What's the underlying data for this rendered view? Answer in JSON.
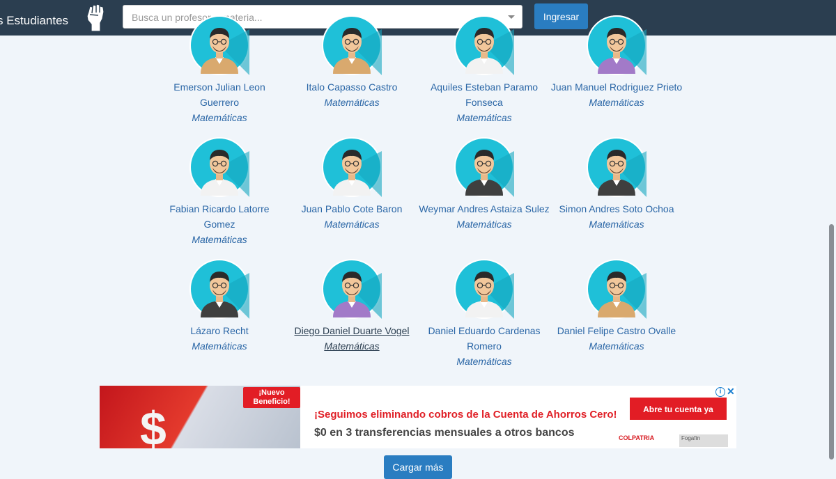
{
  "header": {
    "brand": "s Estudiantes",
    "search_placeholder": "Busca un profesor o materia...",
    "login_label": "Ingresar"
  },
  "teachers": [
    {
      "name": "Emerson Julian Leon Guerrero",
      "subject": "Matemáticas",
      "avatar": "avatar-tan-shirt"
    },
    {
      "name": "Italo Capasso Castro",
      "subject": "Matemáticas",
      "avatar": "avatar-tan-shirt"
    },
    {
      "name": "Aquiles Esteban Paramo Fonseca",
      "subject": "Matemáticas",
      "avatar": "avatar-white-shirt"
    },
    {
      "name": "Juan Manuel Rodriguez Prieto",
      "subject": "Matemáticas",
      "avatar": "avatar-purple-shirt"
    },
    {
      "name": "Fabian Ricardo Latorre Gomez",
      "subject": "Matemáticas",
      "avatar": "avatar-white-shirt"
    },
    {
      "name": "Juan Pablo Cote Baron",
      "subject": "Matemáticas",
      "avatar": "avatar-white-shirt"
    },
    {
      "name": "Weymar Andres Astaiza Sulez",
      "subject": "Matemáticas",
      "avatar": "avatar-dark-shirt"
    },
    {
      "name": "Simon Andres Soto Ochoa",
      "subject": "Matemáticas",
      "avatar": "avatar-dark-shirt"
    },
    {
      "name": "Lázaro Recht",
      "subject": "Matemáticas",
      "avatar": "avatar-dark-shirt"
    },
    {
      "name": "Diego Daniel Duarte Vogel",
      "subject": "Matemáticas",
      "avatar": "avatar-purple-shirt"
    },
    {
      "name": "Daniel Eduardo Cardenas Romero",
      "subject": "Matemáticas",
      "avatar": "avatar-white-shirt"
    },
    {
      "name": "Daniel Felipe Castro Ovalle",
      "subject": "Matemáticas",
      "avatar": "avatar-tan-shirt"
    }
  ],
  "ad": {
    "tag": "¡Nuevo Beneficio!",
    "headline": "¡Seguimos eliminando cobros de la Cuenta de Ahorros Cero!",
    "subline": "$0 en 3 transferencias mensuales a otros bancos",
    "cta": "Abre tu cuenta ya",
    "brand": "COLPATRIA",
    "brand2": "Fogafín",
    "dollar": "$"
  },
  "load_more_label": "Cargar más",
  "colors": {
    "header_bg": "#2b3e50",
    "button_bg": "#2a7dc1",
    "link": "#2a66a6",
    "avatar_bg": "#1fc0d8"
  }
}
